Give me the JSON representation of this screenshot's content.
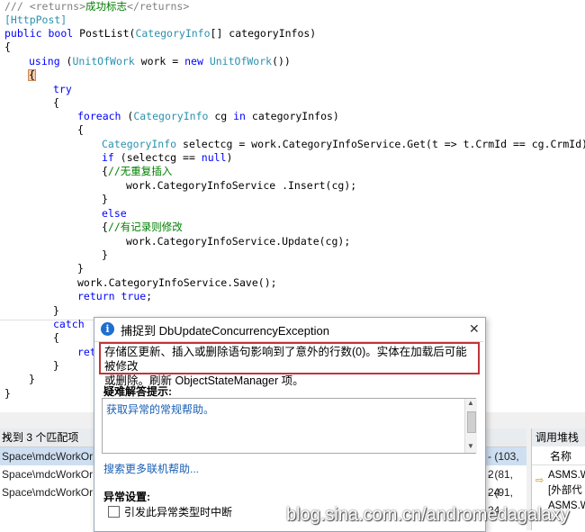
{
  "code": {
    "line1_doc": "/// <returns>",
    "line1_text": "成功标志",
    "line1_end": "</returns>",
    "line2": "[HttpPost]",
    "line3_kw1": "public",
    "line3_kw2": "bool",
    "line3_name": " PostList(",
    "line3_type": "CategoryInfo",
    "line3_rest": "[] categoryInfos)",
    "line4": "{",
    "line5_kw": "using",
    "line5_a": " (",
    "line5_type1": "UnitOfWork",
    "line5_b": " work = ",
    "line5_new": "new",
    "line5_type2": " UnitOfWork",
    "line5_c": "())",
    "line6": "{",
    "line7": "try",
    "line8": "{",
    "line9_kw": "foreach",
    "line9_a": " (",
    "line9_type": "CategoryInfo",
    "line9_b": " cg ",
    "line9_in": "in",
    "line9_c": " categoryInfos)",
    "line10": "{",
    "line11_type": "CategoryInfo",
    "line11_rest": " selectcg = work.CategoryInfoService.Get(t => t.CrmId == cg.CrmId);",
    "line12_kw": "if",
    "line12_a": " (selectcg == ",
    "line12_null": "null",
    "line12_b": ")",
    "line13_brace": "{",
    "line13_comment": "//无重复插入",
    "line14": "work.CategoryInfoService .Insert(cg);",
    "line15": "}",
    "line16": "else",
    "line17_brace": "{",
    "line17_comment": "//有记录则修改",
    "line18": "work.CategoryInfoService.Update(cg);",
    "line19": "}",
    "line20": "}",
    "line21": "work.CategoryInfoService.Save();",
    "line22_kw": "return",
    "line22_val": " true",
    "line22_end": ";",
    "line23": "}",
    "line24": "catch",
    "line25": "{",
    "line26": "ret",
    "line27": "}",
    "line28": "}",
    "line29": "}"
  },
  "popup": {
    "title": "捕捉到 DbUpdateConcurrencyException",
    "message_line1": "存储区更新、插入或删除语句影响到了意外的行数(0)。实体在加载后可能被修改",
    "message_line2": "或删除。刷新 ObjectStateManager 项。",
    "hint_label": "疑难解答提示:",
    "hint_link": "获取异常的常规帮助。",
    "search_link": "搜索更多联机帮助...",
    "settings_label": "异常设置:",
    "checkbox_label": "引发此异常类型时中断",
    "checkbox_checked": false
  },
  "find_panel": {
    "title": "找到 3 个匹配项",
    "rows": [
      {
        "path": "Space\\mdcWorkOr",
        "pos": "- (103, 2"
      },
      {
        "path": "Space\\mdcWorkOr",
        "pos": "- (81, 24"
      },
      {
        "path": "Space\\mdcWorkOr",
        "pos": "- (91, 24"
      }
    ]
  },
  "call_stack": {
    "title": "调用堆栈",
    "column": "名称",
    "rows": [
      "ASMS.W",
      "[外部代",
      "ASMS.W"
    ]
  },
  "watermark": "blog.sina.com.cn/andromedagalaxy"
}
